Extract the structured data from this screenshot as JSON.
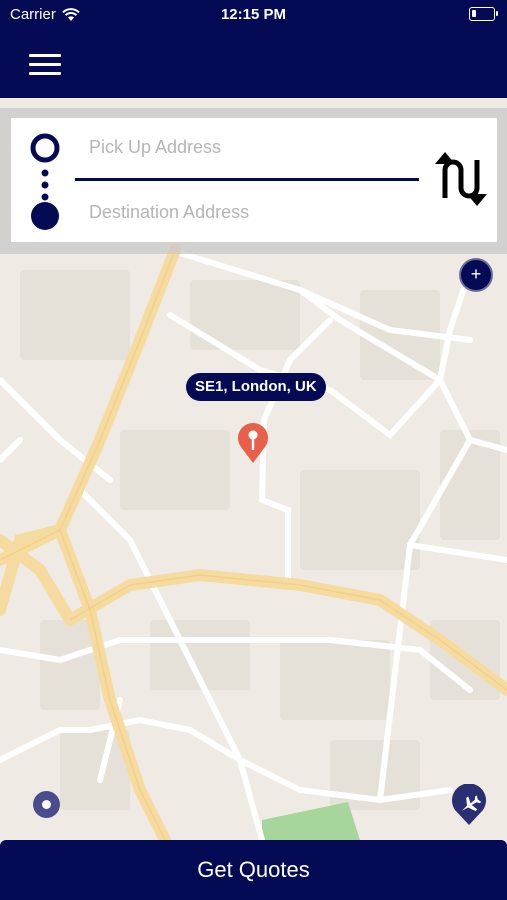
{
  "status_bar": {
    "carrier": "Carrier",
    "time": "12:15 PM",
    "battery_level": 0.2
  },
  "nav": {
    "menu_icon": "hamburger-icon"
  },
  "address": {
    "pickup_placeholder": "Pick Up Address",
    "pickup_value": "",
    "destination_placeholder": "Destination Address",
    "destination_value": "",
    "swap_icon": "swap-arrows-icon"
  },
  "map": {
    "zoom_label": "+",
    "location_label": "SE1, London, UK",
    "pin_icon": "map-pin-icon",
    "locate_icon": "my-location-icon",
    "airport_icon": "airplane-icon"
  },
  "footer": {
    "quotes_label": "Get Quotes"
  },
  "colors": {
    "brand": "#050a55",
    "pin": "#e8604c",
    "map_bg": "#efebe4",
    "road_major": "#f6dba0",
    "road_minor": "#ffffff",
    "park": "#a6d69c"
  }
}
